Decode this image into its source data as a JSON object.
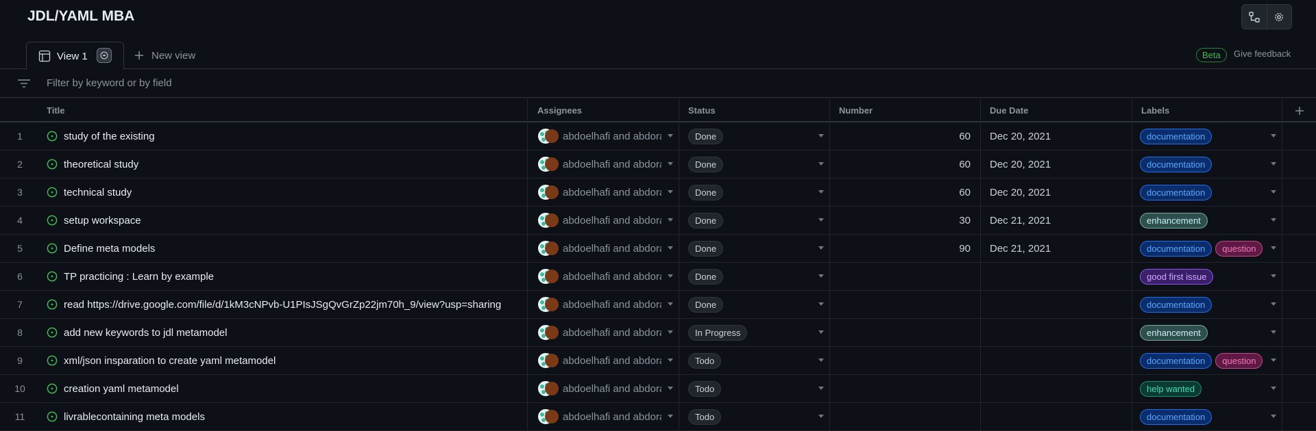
{
  "header": {
    "title": "JDL/YAML MBA",
    "actions": [
      {
        "name": "workflows",
        "icon": "workflow-icon"
      },
      {
        "name": "settings",
        "icon": "gear-icon"
      }
    ]
  },
  "tabs": {
    "views": [
      {
        "label": "View 1",
        "icon": "table-icon"
      }
    ],
    "new_view_label": "New view",
    "beta_label": "Beta",
    "feedback_label": "Give feedback"
  },
  "filter": {
    "placeholder": "Filter by keyword or by field"
  },
  "table": {
    "columns": [
      "Title",
      "Assignees",
      "Status",
      "Number",
      "Due Date",
      "Labels"
    ],
    "rows": [
      {
        "n": "1",
        "title": "study of the existing",
        "assignees": "abdoelhafi and abdorahim",
        "status": "Done",
        "number": "60",
        "due": "Dec 20, 2021",
        "labels": [
          "documentation"
        ]
      },
      {
        "n": "2",
        "title": "theoretical study",
        "assignees": "abdoelhafi and abdorahim",
        "status": "Done",
        "number": "60",
        "due": "Dec 20, 2021",
        "labels": [
          "documentation"
        ]
      },
      {
        "n": "3",
        "title": "technical study",
        "assignees": "abdoelhafi and abdorahim",
        "status": "Done",
        "number": "60",
        "due": "Dec 20, 2021",
        "labels": [
          "documentation"
        ]
      },
      {
        "n": "4",
        "title": "setup workspace",
        "assignees": "abdoelhafi and abdorahim",
        "status": "Done",
        "number": "30",
        "due": "Dec 21, 2021",
        "labels": [
          "enhancement"
        ]
      },
      {
        "n": "5",
        "title": "Define meta models",
        "assignees": "abdoelhafi and abdorahim",
        "status": "Done",
        "number": "90",
        "due": "Dec 21, 2021",
        "labels": [
          "documentation",
          "question"
        ]
      },
      {
        "n": "6",
        "title": "TP practicing : Learn by example",
        "assignees": "abdoelhafi and abdorahim",
        "status": "Done",
        "number": "",
        "due": "",
        "labels": [
          "good first issue"
        ]
      },
      {
        "n": "7",
        "title": "read https://drive.google.com/file/d/1kM3cNPvb-U1PIsJSgQvGrZp22jm70h_9/view?usp=sharing",
        "assignees": "abdoelhafi and abdorahim",
        "status": "Done",
        "number": "",
        "due": "",
        "labels": [
          "documentation"
        ]
      },
      {
        "n": "8",
        "title": "add new keywords to jdl metamodel",
        "assignees": "abdoelhafi and abdorahim",
        "status": "In Progress",
        "number": "",
        "due": "",
        "labels": [
          "enhancement"
        ]
      },
      {
        "n": "9",
        "title": "xml/json insparation to create yaml metamodel",
        "assignees": "abdoelhafi and abdorahim",
        "status": "Todo",
        "number": "",
        "due": "",
        "labels": [
          "documentation",
          "question"
        ]
      },
      {
        "n": "10",
        "title": "creation yaml metamodel",
        "assignees": "abdoelhafi and abdorahim",
        "status": "Todo",
        "number": "",
        "due": "",
        "labels": [
          "help wanted"
        ]
      },
      {
        "n": "11",
        "title": "livrablecontaining meta models",
        "assignees": "abdoelhafi and abdorahim",
        "status": "Todo",
        "number": "",
        "due": "",
        "labels": [
          "documentation"
        ]
      }
    ]
  },
  "colors": {
    "background": "#0d1117",
    "border": "#30363d",
    "open_issue": "#3fb950",
    "documentation": "#1f6feb",
    "enhancement": "#a2eeef",
    "question": "#d876e3",
    "good first issue": "#7057ff",
    "help wanted": "#008672"
  }
}
